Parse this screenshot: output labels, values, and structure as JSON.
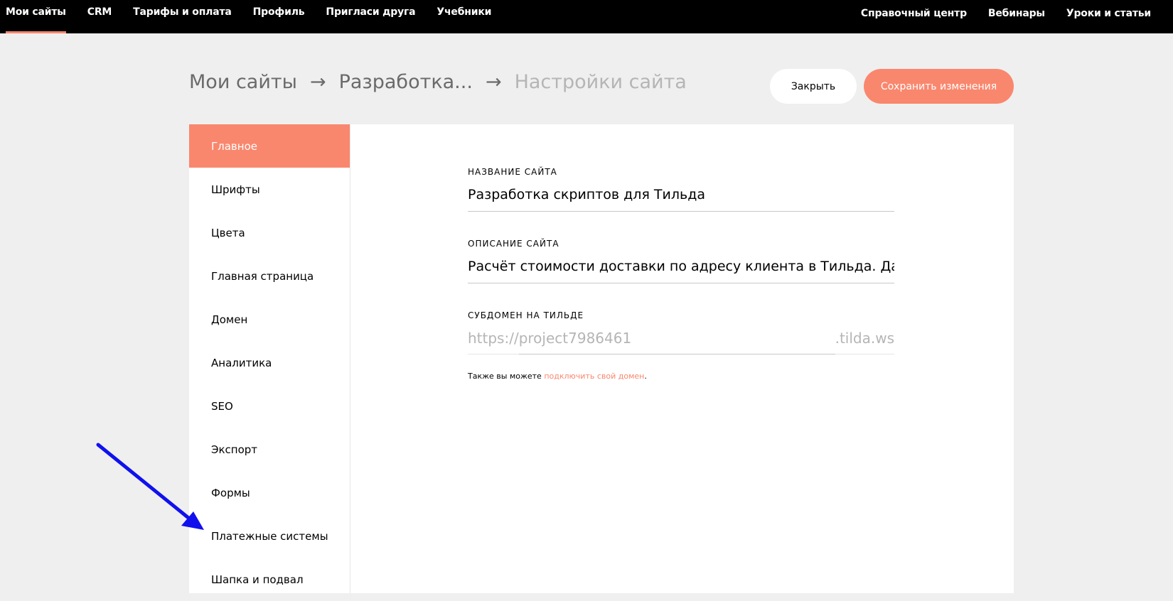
{
  "topnav": {
    "left": [
      {
        "label": "Мои сайты",
        "active": true
      },
      {
        "label": "CRM"
      },
      {
        "label": "Тарифы и оплата"
      },
      {
        "label": "Профиль"
      },
      {
        "label": "Пригласи друга"
      },
      {
        "label": "Учебники"
      }
    ],
    "right": [
      {
        "label": "Справочный центр"
      },
      {
        "label": "Вебинары"
      },
      {
        "label": "Уроки и статьи"
      }
    ]
  },
  "breadcrumb": {
    "root": "Мои сайты",
    "project": "Разработка...",
    "current": "Настройки сайта",
    "separator": "→"
  },
  "actions": {
    "close_label": "Закрыть",
    "save_label": "Сохранить изменения"
  },
  "sidebar": {
    "items": [
      {
        "label": "Главное",
        "active": true
      },
      {
        "label": "Шрифты"
      },
      {
        "label": "Цвета"
      },
      {
        "label": "Главная страница"
      },
      {
        "label": "Домен"
      },
      {
        "label": "Аналитика"
      },
      {
        "label": "SEO"
      },
      {
        "label": "Экспорт"
      },
      {
        "label": "Формы"
      },
      {
        "label": "Платежные системы"
      },
      {
        "label": "Шапка и подвал"
      }
    ]
  },
  "form": {
    "site_name": {
      "label": "НАЗВАНИЕ САЙТА",
      "value": "Разработка скриптов для Тильда"
    },
    "site_description": {
      "label": "ОПИСАНИЕ САЙТА",
      "value": "Расчёт стоимости доставки по адресу клиента в Тильда. Данный"
    },
    "subdomain": {
      "label": "СУБДОМЕН НА ТИЛЬДЕ",
      "prefix": "https://",
      "value": "project7986461",
      "suffix": ".tilda.ws"
    },
    "hint": {
      "text": "Также вы можете ",
      "link": "подключить свой домен",
      "end": "."
    }
  },
  "colors": {
    "accent": "#f9876e",
    "topbar": "#000000",
    "background": "#efefef",
    "annotation_arrow": "#1010ee"
  }
}
